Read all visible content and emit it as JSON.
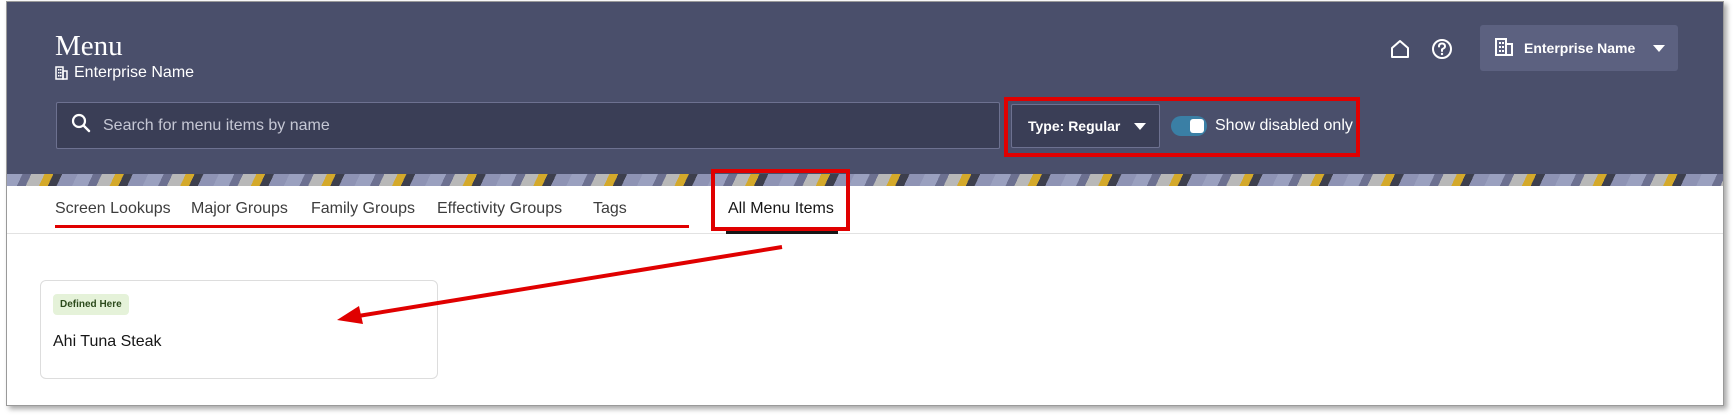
{
  "header": {
    "title": "Menu",
    "subtitle": "Enterprise Name",
    "enterprise_button": "Enterprise Name"
  },
  "icons": {
    "home": "home-icon",
    "help": "help-icon",
    "building": "building-icon",
    "search": "search-icon",
    "caret": "caret-down-icon"
  },
  "search": {
    "placeholder": "Search for menu items by name",
    "value": ""
  },
  "filters": {
    "type_label": "Type: Regular",
    "toggle_label": "Show disabled only",
    "toggle_on": true
  },
  "tabs": [
    {
      "label": "Screen Lookups",
      "active": false
    },
    {
      "label": "Major Groups",
      "active": false
    },
    {
      "label": "Family Groups",
      "active": false
    },
    {
      "label": "Effectivity Groups",
      "active": false
    },
    {
      "label": "Tags",
      "active": false
    },
    {
      "label": "All Menu Items",
      "active": true
    }
  ],
  "cards": [
    {
      "badge": "Defined Here",
      "title": "Ahi Tuna Steak"
    }
  ],
  "colors": {
    "header_bg": "#4a4f6b",
    "highlight": "#e00000",
    "toggle": "#3a7fa5",
    "badge_bg": "#e5f2d9"
  }
}
